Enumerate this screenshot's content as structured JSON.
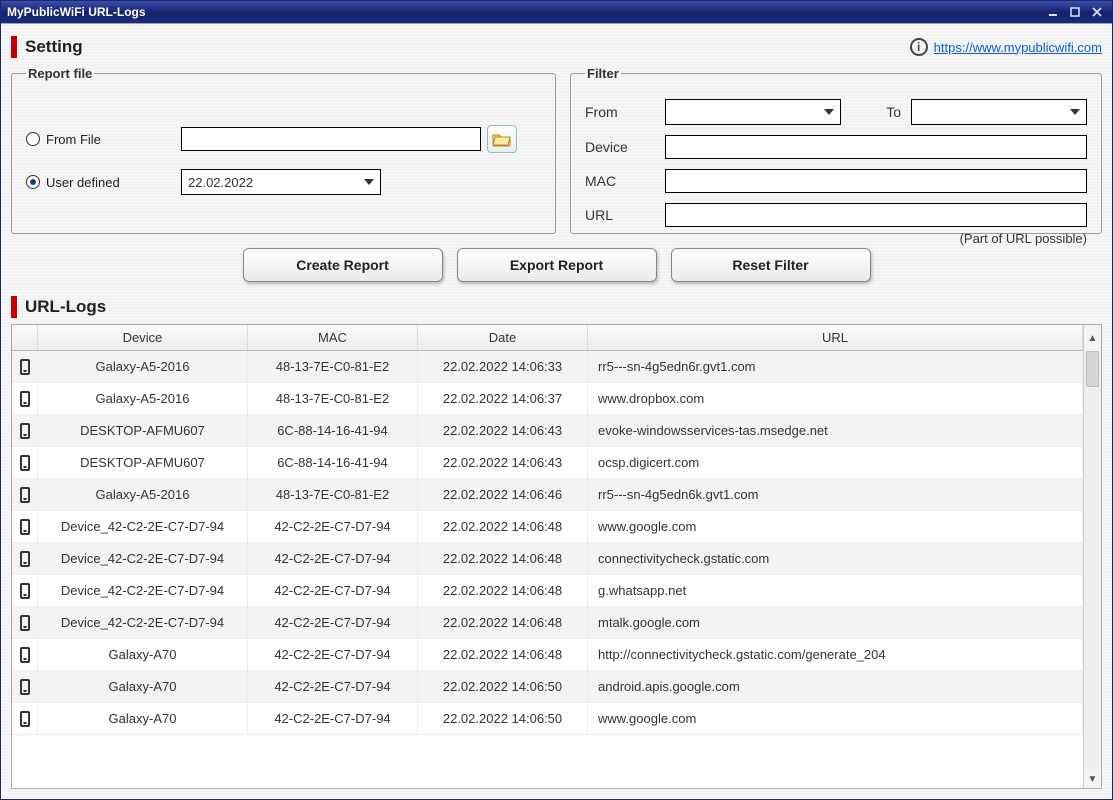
{
  "window": {
    "title": "MyPublicWiFi  URL-Logs"
  },
  "header": {
    "title": "Setting",
    "link_text": "https://www.mypublicwifi.com"
  },
  "report_file": {
    "legend": "Report file",
    "from_file_label": "From File",
    "user_defined_label": "User defined",
    "from_file_value": "",
    "user_defined_value": "22.02.2022",
    "selected": "user_defined"
  },
  "filter": {
    "legend": "Filter",
    "from_label": "From",
    "to_label": "To",
    "device_label": "Device",
    "mac_label": "MAC",
    "url_label": "URL",
    "from_value": "",
    "to_value": "",
    "device_value": "",
    "mac_value": "",
    "url_value": "",
    "hint": "(Part of URL possible)"
  },
  "actions": {
    "create": "Create Report",
    "export": "Export Report",
    "reset": "Reset Filter"
  },
  "logs": {
    "title": "URL-Logs",
    "columns": {
      "device": "Device",
      "mac": "MAC",
      "date": "Date",
      "url": "URL"
    },
    "rows": [
      {
        "device": "Galaxy-A5-2016",
        "mac": "48-13-7E-C0-81-E2",
        "date": "22.02.2022 14:06:33",
        "url": "rr5---sn-4g5edn6r.gvt1.com"
      },
      {
        "device": "Galaxy-A5-2016",
        "mac": "48-13-7E-C0-81-E2",
        "date": "22.02.2022 14:06:37",
        "url": "www.dropbox.com"
      },
      {
        "device": "DESKTOP-AFMU607",
        "mac": "6C-88-14-16-41-94",
        "date": "22.02.2022 14:06:43",
        "url": "evoke-windowsservices-tas.msedge.net"
      },
      {
        "device": "DESKTOP-AFMU607",
        "mac": "6C-88-14-16-41-94",
        "date": "22.02.2022 14:06:43",
        "url": "ocsp.digicert.com"
      },
      {
        "device": "Galaxy-A5-2016",
        "mac": "48-13-7E-C0-81-E2",
        "date": "22.02.2022 14:06:46",
        "url": "rr5---sn-4g5edn6k.gvt1.com"
      },
      {
        "device": "Device_42-C2-2E-C7-D7-94",
        "mac": "42-C2-2E-C7-D7-94",
        "date": "22.02.2022 14:06:48",
        "url": "www.google.com"
      },
      {
        "device": "Device_42-C2-2E-C7-D7-94",
        "mac": "42-C2-2E-C7-D7-94",
        "date": "22.02.2022 14:06:48",
        "url": "connectivitycheck.gstatic.com"
      },
      {
        "device": "Device_42-C2-2E-C7-D7-94",
        "mac": "42-C2-2E-C7-D7-94",
        "date": "22.02.2022 14:06:48",
        "url": "g.whatsapp.net"
      },
      {
        "device": "Device_42-C2-2E-C7-D7-94",
        "mac": "42-C2-2E-C7-D7-94",
        "date": "22.02.2022 14:06:48",
        "url": "mtalk.google.com"
      },
      {
        "device": "Galaxy-A70",
        "mac": "42-C2-2E-C7-D7-94",
        "date": "22.02.2022 14:06:48",
        "url": "http://connectivitycheck.gstatic.com/generate_204"
      },
      {
        "device": "Galaxy-A70",
        "mac": "42-C2-2E-C7-D7-94",
        "date": "22.02.2022 14:06:50",
        "url": "android.apis.google.com"
      },
      {
        "device": "Galaxy-A70",
        "mac": "42-C2-2E-C7-D7-94",
        "date": "22.02.2022 14:06:50",
        "url": "www.google.com"
      }
    ]
  }
}
